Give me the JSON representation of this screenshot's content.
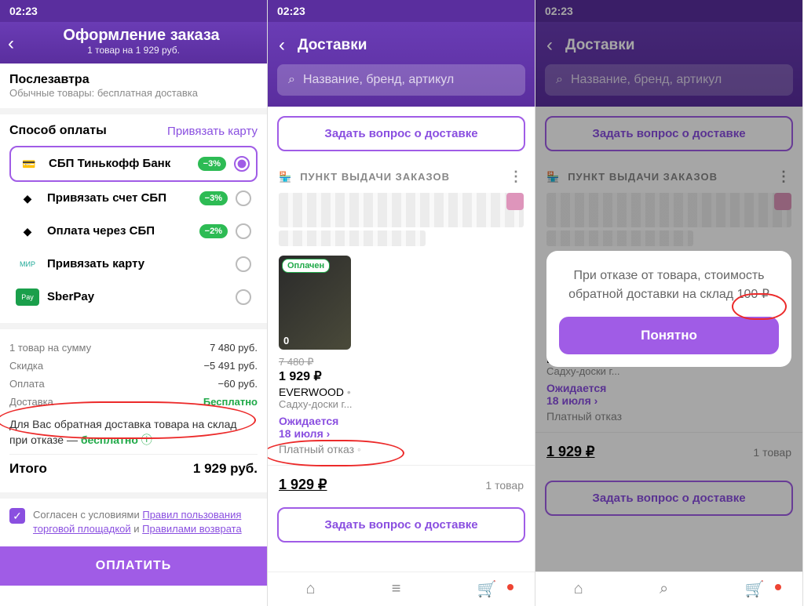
{
  "time": "02:23",
  "s1": {
    "title": "Оформление заказа",
    "subtitle": "1 товар на 1 929 руб.",
    "delivery_day": "Послезавтра",
    "delivery_note": "Обычные товары: бесплатная доставка",
    "payment_header": "Способ оплаты",
    "link_card": "Привязать карту",
    "options": [
      {
        "name": "СБП Тинькофф Банк",
        "discount": "−3%",
        "selected": true
      },
      {
        "name": "Привязать счет СБП",
        "discount": "−3%",
        "selected": false
      },
      {
        "name": "Оплата через СБП",
        "discount": "−2%",
        "selected": false
      },
      {
        "name": "Привязать карту",
        "discount": "",
        "selected": false
      },
      {
        "name": "SberPay",
        "discount": "",
        "selected": false
      }
    ],
    "summary": [
      {
        "label": "1 товар на сумму",
        "value": "7 480 руб."
      },
      {
        "label": "Скидка",
        "value": "−5 491 руб."
      },
      {
        "label": "Оплата",
        "value": "−60 руб."
      },
      {
        "label": "Доставка",
        "value": "Бесплатно",
        "green": true
      }
    ],
    "return_text_a": "Для Вас обратная доставка товара на склад при отказе — ",
    "return_text_b": "бесплатно",
    "total_label": "Итого",
    "total_value": "1 929 руб.",
    "agree_a": "Согласен с условиями ",
    "agree_b": "Правил пользования торговой площадкой",
    "agree_c": " и ",
    "agree_d": "Правилами возврата",
    "pay_button": "ОПЛАТИТЬ"
  },
  "s2": {
    "title": "Доставки",
    "search_placeholder": "Название, бренд, артикул",
    "ask_button": "Задать вопрос о доставке",
    "pvz_label": "ПУНКТ ВЫДАЧИ ЗАКАЗОВ",
    "paid_badge": "Оплачен",
    "qty": "0",
    "old_price": "7 480 ₽",
    "price": "1 929 ₽",
    "brand": "EVERWOOD",
    "product_name": "Садху-доски г...",
    "expected": "Ожидается",
    "date": "18 июля ›",
    "paid_refusal": "Платный отказ",
    "total_price": "1 929 ₽",
    "total_count": "1 товар"
  },
  "s3": {
    "modal_text": "При отказе от товара, стоимость обратной доставки на склад 100 ₽",
    "ok": "Понятно"
  }
}
